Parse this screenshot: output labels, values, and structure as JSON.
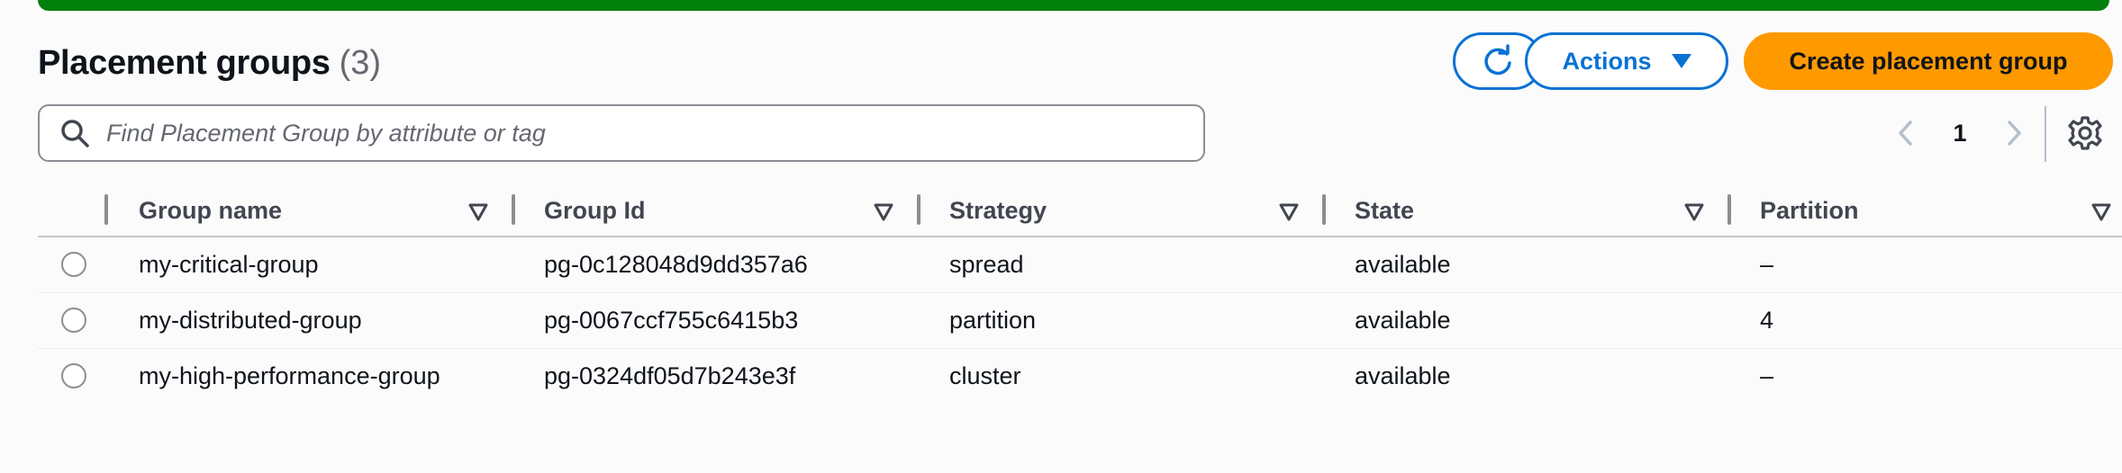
{
  "header": {
    "title": "Placement groups",
    "count": "(3)"
  },
  "toolbar": {
    "refresh_icon": "refresh-icon",
    "actions_label": "Actions",
    "create_label": "Create placement group",
    "accent_color": "#0972d3",
    "primary_color": "#ff9900",
    "flash_color": "#037f0c"
  },
  "search": {
    "placeholder": "Find Placement Group by attribute or tag"
  },
  "pagination": {
    "current_page": "1"
  },
  "table": {
    "columns": [
      "Group name",
      "Group Id",
      "Strategy",
      "State",
      "Partition"
    ],
    "rows": [
      {
        "name": "my-critical-group",
        "id": "pg-0c128048d9dd357a6",
        "strategy": "spread",
        "state": "available",
        "partition": "–"
      },
      {
        "name": "my-distributed-group",
        "id": "pg-0067ccf755c6415b3",
        "strategy": "partition",
        "state": "available",
        "partition": "4"
      },
      {
        "name": "my-high-performance-group",
        "id": "pg-0324df05d7b243e3f",
        "strategy": "cluster",
        "state": "available",
        "partition": "–"
      }
    ]
  }
}
